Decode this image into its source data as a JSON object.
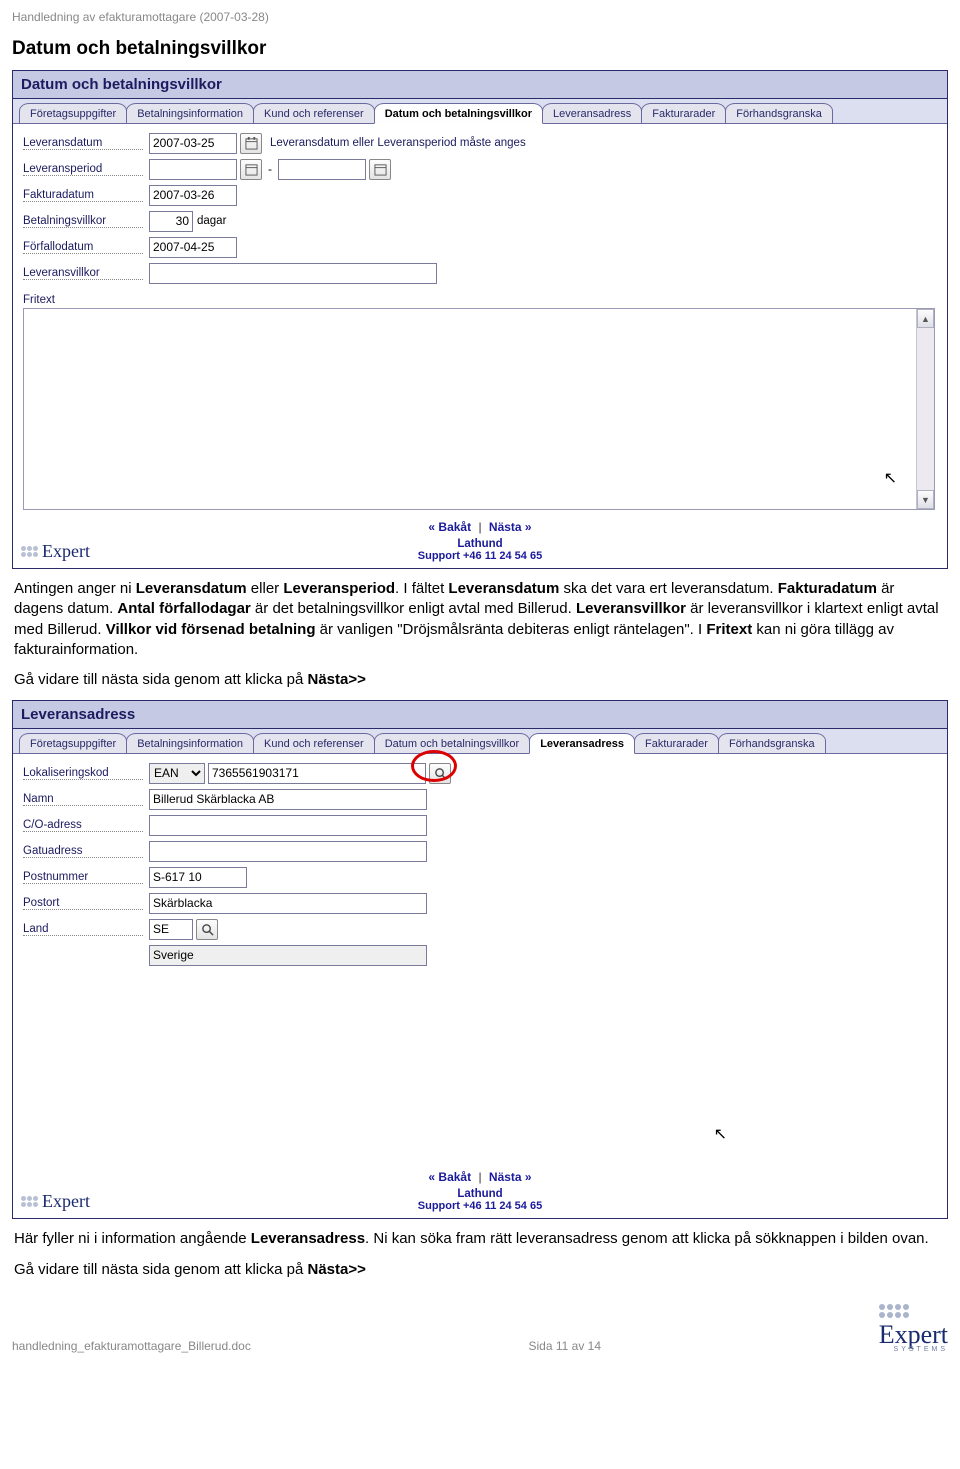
{
  "doc": {
    "header": "Handledning av efakturamottagare (2007-03-28)",
    "footer_file": "handledning_efakturamottagare_Billerud.doc",
    "footer_page": "Sida 11 av 14",
    "logo_text": "Expert",
    "logo_sub": "SYSTEMS"
  },
  "section1": {
    "heading": "Datum och betalningsvillkor",
    "panel_title": "Datum och betalningsvillkor",
    "tabs": [
      "Företagsuppgifter",
      "Betalningsinformation",
      "Kund och referenser",
      "Datum och betalningsvillkor",
      "Leveransadress",
      "Fakturarader",
      "Förhandsgranska"
    ],
    "active_tab": 3,
    "rows": {
      "leveransdatum_label": "Leveransdatum",
      "leveransdatum_value": "2007-03-25",
      "leveransdatum_hint": "Leveransdatum eller Leveransperiod måste anges",
      "leveransperiod_label": "Leveransperiod",
      "leveransperiod_from": "",
      "leveransperiod_to": "",
      "leveransperiod_sep": "-",
      "fakturadatum_label": "Fakturadatum",
      "fakturadatum_value": "2007-03-26",
      "betalningsvillkor_label": "Betalningsvillkor",
      "betalningsvillkor_value": "30",
      "betalningsvillkor_unit": "dagar",
      "forfallodatum_label": "Förfallodatum",
      "forfallodatum_value": "2007-04-25",
      "leveransvillkor_label": "Leveransvillkor",
      "leveransvillkor_value": "",
      "fritext_label": "Fritext"
    },
    "nav_back": "« Bakåt",
    "nav_next": "Nästa »",
    "lathund": "Lathund",
    "support": "Support +46 11 24 54 65",
    "para": "Antingen anger ni <b>Leveransdatum</b> eller <b>Leveransperiod</b>. I fältet <b>Leveransdatum</b> ska det vara ert leveransdatum. <b>Fakturadatum</b> är dagens datum. <b>Antal förfallodagar</b> är det betalningsvillkor enligt avtal med Billerud. <b>Leveransvillkor</b> är leveransvillkor i klartext enligt avtal med Billerud. <b>Villkor vid försenad betalning</b> är vanligen \"Dröjsmålsränta debiteras enligt räntelagen\". I <b>Fritext</b> kan ni göra tillägg av fakturainformation.",
    "para2": "Gå vidare till nästa sida genom att klicka på <b>Nästa>></b>"
  },
  "section2": {
    "panel_title": "Leveransadress",
    "tabs": [
      "Företagsuppgifter",
      "Betalningsinformation",
      "Kund och referenser",
      "Datum och betalningsvillkor",
      "Leveransadress",
      "Fakturarader",
      "Förhandsgranska"
    ],
    "active_tab": 4,
    "rows": {
      "lokkod_label": "Lokaliseringskod",
      "lokkod_type": "EAN",
      "lokkod_value": "7365561903171",
      "namn_label": "Namn",
      "namn_value": "Billerud Skärblacka AB",
      "co_label": "C/O-adress",
      "co_value": "",
      "gatu_label": "Gatuadress",
      "gatu_value": "",
      "post_label": "Postnummer",
      "post_value": "S-617 10",
      "ort_label": "Postort",
      "ort_value": "Skärblacka",
      "land_label": "Land",
      "land_code": "SE",
      "land_name": "Sverige"
    },
    "nav_back": "« Bakåt",
    "nav_next": "Nästa »",
    "lathund": "Lathund",
    "support": "Support +46 11 24 54 65",
    "para": "Här fyller ni i information angående <b>Leveransadress</b>. Ni kan söka fram rätt leveransadress genom att klicka på sökknappen i bilden ovan.",
    "para2": "Gå vidare till nästa sida genom att klicka på <b>Nästa>></b>"
  }
}
